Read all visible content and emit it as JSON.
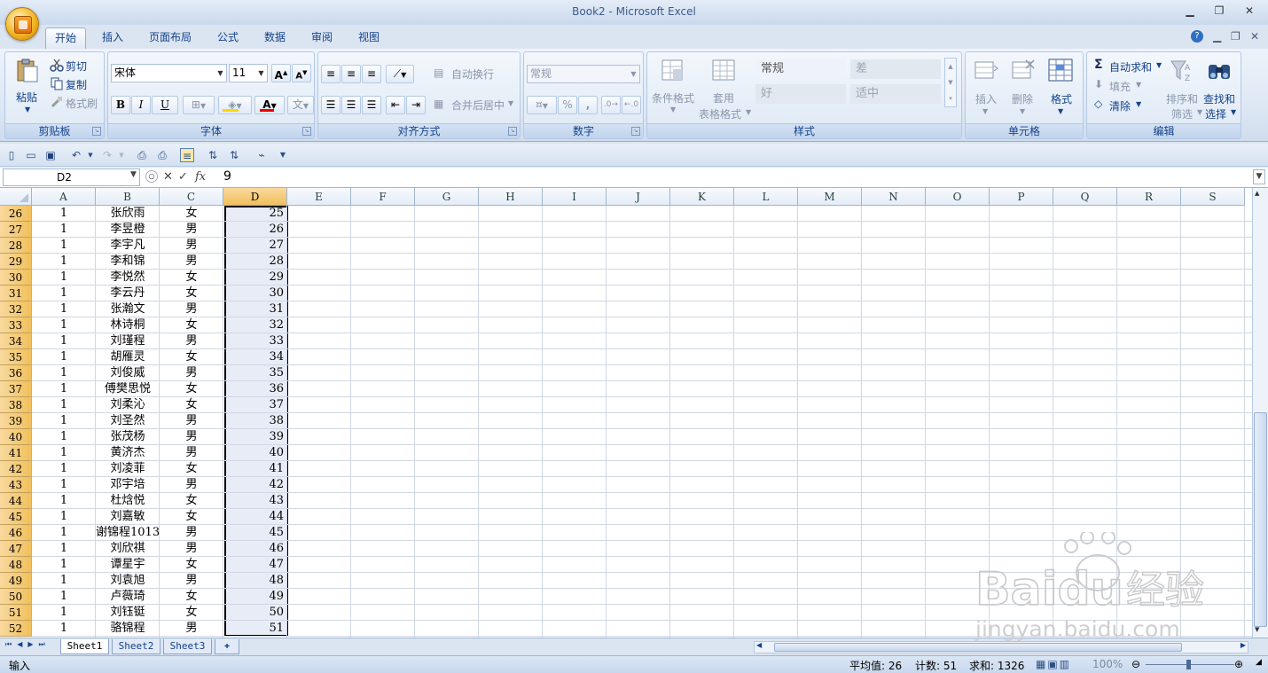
{
  "title": "Book2 - Microsoft Excel",
  "tabs": [
    "开始",
    "插入",
    "页面布局",
    "公式",
    "数据",
    "审阅",
    "视图"
  ],
  "ribbon": {
    "clipboard": {
      "label": "剪贴板",
      "paste": "粘贴",
      "cut": "剪切",
      "copy": "复制",
      "format_painter": "格式刷"
    },
    "font": {
      "label": "字体",
      "name": "宋体",
      "size": "11",
      "bold": "B",
      "italic": "I",
      "underline": "U"
    },
    "alignment": {
      "label": "对齐方式",
      "wrap": "自动换行",
      "merge": "合并后居中"
    },
    "number": {
      "label": "数字",
      "format": "常规",
      "percent": "%",
      "comma": ","
    },
    "styles": {
      "label": "样式",
      "conditional": "条件格式",
      "table_format_1": "套用",
      "table_format_2": "表格格式",
      "normal": "常规",
      "bad": "差",
      "good": "好",
      "neutral": "适中"
    },
    "cells": {
      "label": "单元格",
      "insert": "插入",
      "delete": "删除",
      "format": "格式"
    },
    "editing": {
      "label": "编辑",
      "autosum": "自动求和",
      "fill": "填充",
      "clear": "清除",
      "sort_1": "排序和",
      "sort_2": "筛选",
      "find_1": "查找和",
      "find_2": "选择"
    }
  },
  "formula_bar": {
    "name_box": "D2",
    "fx": "fx",
    "value": "9"
  },
  "columns": [
    "A",
    "B",
    "C",
    "D",
    "E",
    "F",
    "G",
    "H",
    "I",
    "J",
    "K",
    "L",
    "M",
    "N",
    "O",
    "P",
    "Q",
    "R",
    "S"
  ],
  "rows": [
    {
      "n": "26",
      "a": "1",
      "b": "张欣雨",
      "c": "女",
      "d": "25"
    },
    {
      "n": "27",
      "a": "1",
      "b": "李昱橙",
      "c": "男",
      "d": "26"
    },
    {
      "n": "28",
      "a": "1",
      "b": "李宇凡",
      "c": "男",
      "d": "27"
    },
    {
      "n": "29",
      "a": "1",
      "b": "李和锦",
      "c": "男",
      "d": "28"
    },
    {
      "n": "30",
      "a": "1",
      "b": "李悦然",
      "c": "女",
      "d": "29"
    },
    {
      "n": "31",
      "a": "1",
      "b": "李云丹",
      "c": "女",
      "d": "30"
    },
    {
      "n": "32",
      "a": "1",
      "b": "张瀚文",
      "c": "男",
      "d": "31"
    },
    {
      "n": "33",
      "a": "1",
      "b": "林诗桐",
      "c": "女",
      "d": "32"
    },
    {
      "n": "34",
      "a": "1",
      "b": "刘瑾程",
      "c": "男",
      "d": "33"
    },
    {
      "n": "35",
      "a": "1",
      "b": "胡雁灵",
      "c": "女",
      "d": "34"
    },
    {
      "n": "36",
      "a": "1",
      "b": "刘俊威",
      "c": "男",
      "d": "35"
    },
    {
      "n": "37",
      "a": "1",
      "b": "傅樊思悦",
      "c": "女",
      "d": "36"
    },
    {
      "n": "38",
      "a": "1",
      "b": "刘柔沁",
      "c": "女",
      "d": "37"
    },
    {
      "n": "39",
      "a": "1",
      "b": "刘圣然",
      "c": "男",
      "d": "38"
    },
    {
      "n": "40",
      "a": "1",
      "b": "张茂杨",
      "c": "男",
      "d": "39"
    },
    {
      "n": "41",
      "a": "1",
      "b": "黄济杰",
      "c": "男",
      "d": "40"
    },
    {
      "n": "42",
      "a": "1",
      "b": "刘凌菲",
      "c": "女",
      "d": "41"
    },
    {
      "n": "43",
      "a": "1",
      "b": "邓宇培",
      "c": "男",
      "d": "42"
    },
    {
      "n": "44",
      "a": "1",
      "b": "杜焓悦",
      "c": "女",
      "d": "43"
    },
    {
      "n": "45",
      "a": "1",
      "b": "刘嘉敏",
      "c": "女",
      "d": "44"
    },
    {
      "n": "46",
      "a": "1",
      "b": "谢锦程1013",
      "c": "男",
      "d": "45"
    },
    {
      "n": "47",
      "a": "1",
      "b": "刘欣祺",
      "c": "男",
      "d": "46"
    },
    {
      "n": "48",
      "a": "1",
      "b": "谭星宇",
      "c": "女",
      "d": "47"
    },
    {
      "n": "49",
      "a": "1",
      "b": "刘袁旭",
      "c": "男",
      "d": "48"
    },
    {
      "n": "50",
      "a": "1",
      "b": "卢薇琦",
      "c": "女",
      "d": "49"
    },
    {
      "n": "51",
      "a": "1",
      "b": "刘钰铤",
      "c": "女",
      "d": "50"
    },
    {
      "n": "52",
      "a": "1",
      "b": "骆锦程",
      "c": "男",
      "d": "51"
    }
  ],
  "sheets": [
    "Sheet1",
    "Sheet2",
    "Sheet3"
  ],
  "status": {
    "mode": "输入",
    "average": "平均值: 26",
    "count": "计数: 51",
    "sum": "求和: 1326",
    "zoom": "100%"
  },
  "watermark": {
    "brand": "Baidu",
    "brand_cn": "经验",
    "url": "jingyan.baidu.com"
  }
}
